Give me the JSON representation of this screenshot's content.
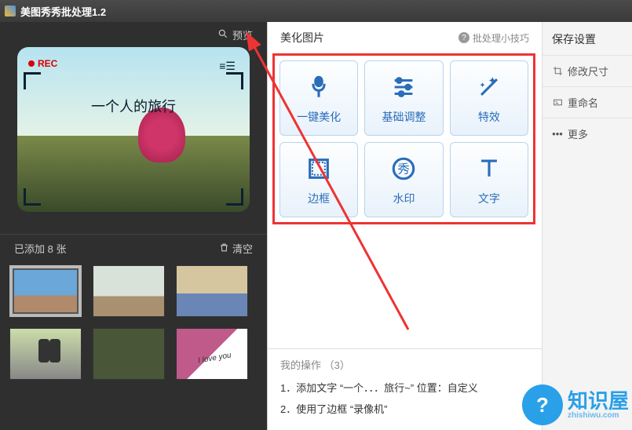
{
  "title": "美图秀秀批处理1.2",
  "left": {
    "preview_label": "预览",
    "image_caption": "一个人的旅行",
    "rec_label": "REC",
    "added_label": "已添加 8 张",
    "clear_label": "清空"
  },
  "center": {
    "header": "美化图片",
    "tips_label": "批处理小技巧",
    "tools": [
      {
        "label": "一键美化",
        "icon": "flower"
      },
      {
        "label": "基础调整",
        "icon": "sliders"
      },
      {
        "label": "特效",
        "icon": "wand"
      },
      {
        "label": "边框",
        "icon": "frame"
      },
      {
        "label": "水印",
        "icon": "stamp"
      },
      {
        "label": "文字",
        "icon": "text"
      }
    ],
    "ops_title": "我的操作 （3）",
    "ops": [
      "1．添加文字 “一个．．．旅行~” 位置：自定义",
      "2．使用了边框 “录像机”"
    ]
  },
  "right": {
    "header": "保存设置",
    "items": [
      {
        "label": "修改尺寸",
        "icon": "crop"
      },
      {
        "label": "重命名",
        "icon": "rename"
      },
      {
        "label": "更多",
        "icon": "more"
      }
    ]
  },
  "watermark": {
    "brand": "知识屋",
    "domain": "zhishiwu.com",
    "q": "?"
  }
}
